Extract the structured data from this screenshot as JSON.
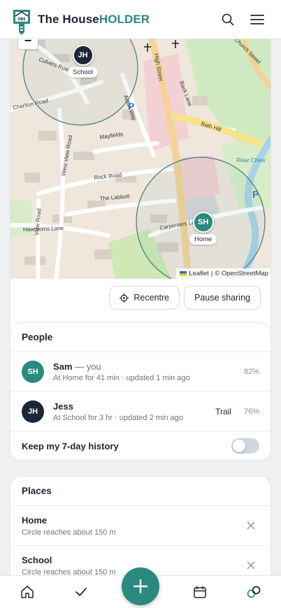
{
  "header": {
    "brand_part1": "The House",
    "brand_part2": "HOLDER",
    "logo_letters": "HH",
    "icons": [
      "search-icon",
      "menu-icon"
    ]
  },
  "map": {
    "zoom_out_label": "−",
    "attribution_leaflet": "Leaflet",
    "attribution_separator": "|",
    "attribution_osm": "© OpenStreetMap",
    "street_labels": [
      "Culvers Road",
      "Charlton Road",
      "West View Road",
      "View Road",
      "Acton Way",
      "Mayfields",
      "Rock Road",
      "The Labbott",
      "Hawthorns Lane",
      "Carpenters Lane",
      "High Street",
      "Back Lane",
      "Bath Hill",
      "River Chew",
      "Church Street"
    ],
    "poi_labels": [
      "P",
      "P"
    ],
    "markers": [
      {
        "initials": "JH",
        "label": "School"
      },
      {
        "initials": "SH",
        "label": "Home"
      }
    ],
    "colors": {
      "accent": "#2a8a80",
      "dark": "#1b2636"
    }
  },
  "map_actions": {
    "recentre_label": "Recentre",
    "pause_label": "Pause sharing"
  },
  "people": {
    "title": "People",
    "items": [
      {
        "initials": "SH",
        "name": "Sam",
        "suffix": " — you",
        "status": "At Home for 41 min · updated 1 min ago",
        "trail": "",
        "battery": "82%"
      },
      {
        "initials": "JH",
        "name": "Jess",
        "suffix": "",
        "status": "At School for 3 hr · updated 2 min ago",
        "trail": "Trail",
        "battery": "76%"
      }
    ],
    "history_label": "Keep my 7-day history",
    "history_enabled": false
  },
  "places": {
    "title": "Places",
    "items": [
      {
        "name": "Home",
        "detail": "Circle reaches about 150 m"
      },
      {
        "name": "School",
        "detail": "Circle reaches about 150 m"
      }
    ]
  },
  "bottom_nav": {
    "items": [
      "home-icon",
      "check-icon",
      "calendar-icon",
      "link-icon"
    ],
    "fab": "plus-icon"
  }
}
